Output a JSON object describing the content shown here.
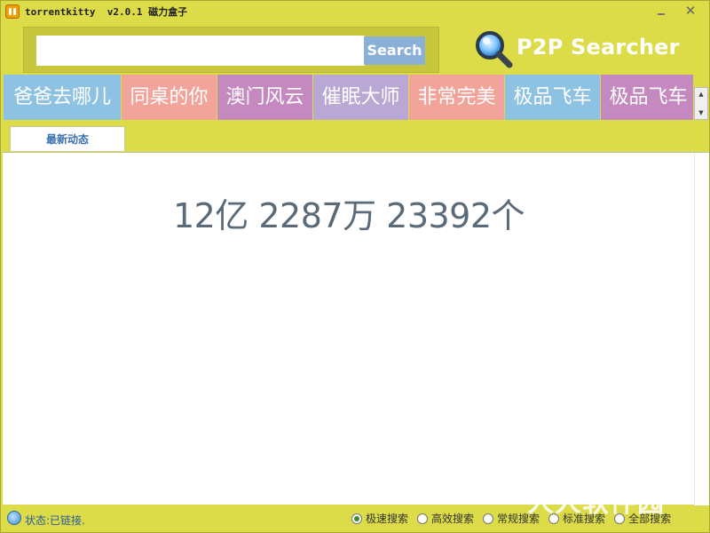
{
  "window": {
    "title": "torrentkitty  v2.0.1 磁力盒子"
  },
  "search": {
    "value": "",
    "placeholder": "",
    "button_label": "Search"
  },
  "brand": {
    "name": "P2P Searcher",
    "icon": "magnifier-icon"
  },
  "tags": [
    {
      "label": "爸爸去哪儿",
      "color": "#8ec2e2"
    },
    {
      "label": "同桌的你",
      "color": "#f2a39a"
    },
    {
      "label": "澳门风云",
      "color": "#c48ac0"
    },
    {
      "label": "催眠大师",
      "color": "#b9a7d4"
    },
    {
      "label": "非常完美",
      "color": "#f2a39a"
    },
    {
      "label": "极品飞车",
      "color": "#8ec2e2"
    },
    {
      "label": "极品飞车",
      "color": "#c48ac0"
    }
  ],
  "tabs": {
    "active": "最新动态"
  },
  "main": {
    "count_text": "12亿 2287万 23392个"
  },
  "status": {
    "text": "状态:已链接.",
    "options": [
      {
        "label": "极速搜索",
        "checked": true
      },
      {
        "label": "高效搜索",
        "checked": false
      },
      {
        "label": "常规搜索",
        "checked": false
      },
      {
        "label": "标准搜索",
        "checked": false
      },
      {
        "label": "全部搜索",
        "checked": false
      }
    ]
  },
  "watermark": "人人软件园"
}
